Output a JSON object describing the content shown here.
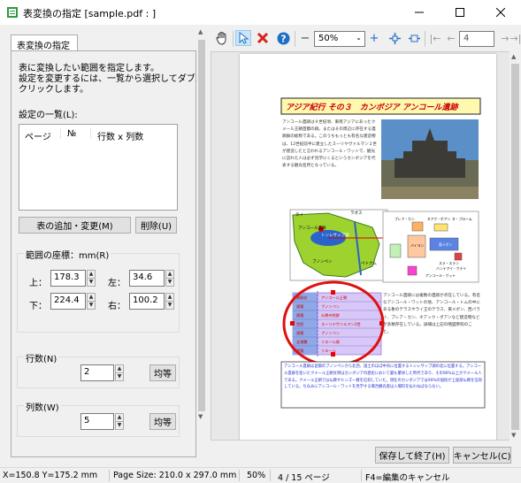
{
  "window": {
    "title": "表変換の指定 [sample.pdf : ]"
  },
  "left_panel": {
    "tab_label": "表変換の指定",
    "instructions": [
      "表に変換したい範囲を指定します。",
      "設定を変更するには、一覧から選択してダブル",
      "クリックします。"
    ],
    "settings_list_label": "設定の一覧(L):",
    "list_columns": [
      "ページ",
      "№",
      "行数 x 列数"
    ],
    "add_change_button": "表の追加・変更(M)",
    "delete_button": "削除(U)",
    "coords": {
      "label": "範囲の座標：mm(R)",
      "top_label": "上：",
      "top_value": "178.3",
      "left_label": "左：",
      "left_value": "34.6",
      "bottom_label": "下：",
      "bottom_value": "224.4",
      "right_label": "右：",
      "right_value": "100.2"
    },
    "rows": {
      "label": "行数(N)",
      "value": "2",
      "equalize_button": "均等"
    },
    "cols": {
      "label": "列数(W)",
      "value": "5",
      "equalize_button": "均等"
    }
  },
  "toolbar": {
    "zoom_value": "50%",
    "page_value": "4"
  },
  "document": {
    "heading": "アジア紀行 その３　カンボジア アンコール遺跡",
    "body_text": "アンコール遺跡は９世紀頃、東南アジアにあったクメール王朝首都の跡。またはその周辺に存在する遺跡群の総称である。このうちもっとも有名な建造物は、12世紀前半に建立したスーリヤヴァルマン２世が建造したと言われるアンコール・ワットで、観光に訪れた人は必ず見学にくるというカンボジアを代表する観光名所となっている。",
    "map_labels": [
      "タイ",
      "ラオス",
      "アンコール遺跡",
      "トンレサップ湖",
      "プノンペン",
      "ベトナム"
    ],
    "plan_labels": [
      "プレア・カン",
      "ネアク・ポアン",
      "タ・プローム",
      "東メボン",
      "バイヨン",
      "スラ・スラン",
      "バンテアイ・クデイ",
      "アンコール・ワット"
    ],
    "side_text": "アンコール遺跡には複数の遺跡が点在している。有名なアンコール・ワットの他、アンコール・トムの中にある象のテラスやライ王のテラス、東メボン、西バライ、プレア・カン、ネアック・ポアンなど建造物などが多数存在している。詳細は上記の略図参照のこと。",
    "table_rows": [
      [
        "遺跡名",
        "アンコール王朝"
      ],
      [
        "建築",
        "プノンペン"
      ],
      [
        "建築",
        "仏教寺院群"
      ],
      [
        "世紀",
        "スーリヤヴァルマン2世"
      ],
      [
        "建築",
        "プノンペン"
      ],
      [
        "会場費",
        "リエール貨"
      ],
      [
        "建築",
        "リエール"
      ]
    ],
    "footer_text": "アンコール遺跡は首都のプノンペンから北西、国土のほぼ中央に位置するトンレサップ湖の北に位置する。アンコール遺跡を巡いたクメール王朝文明はカンボジアの歴史において最も繁栄した時代であり、その90%以上がクメール人である。クメール王朝では仏教やヒンズー教を信仰していた。現在のカンボジアでは90%の国民が上座部仏教を信仰している。ちなみにアンコール・ワットを見学する場合観光客は入場料を払わねばならない。"
  },
  "bottom_buttons": {
    "save": "保存して終了(H)",
    "cancel": "キャンセル(C)"
  },
  "status": {
    "coords": "X=150.8 Y=175.2 mm",
    "page_size": "Page Size: 210.0 x 297.0 mm",
    "zoom": "50%",
    "page": "4 / 15 ページ",
    "hint": "F4=編集のキャンセル"
  }
}
